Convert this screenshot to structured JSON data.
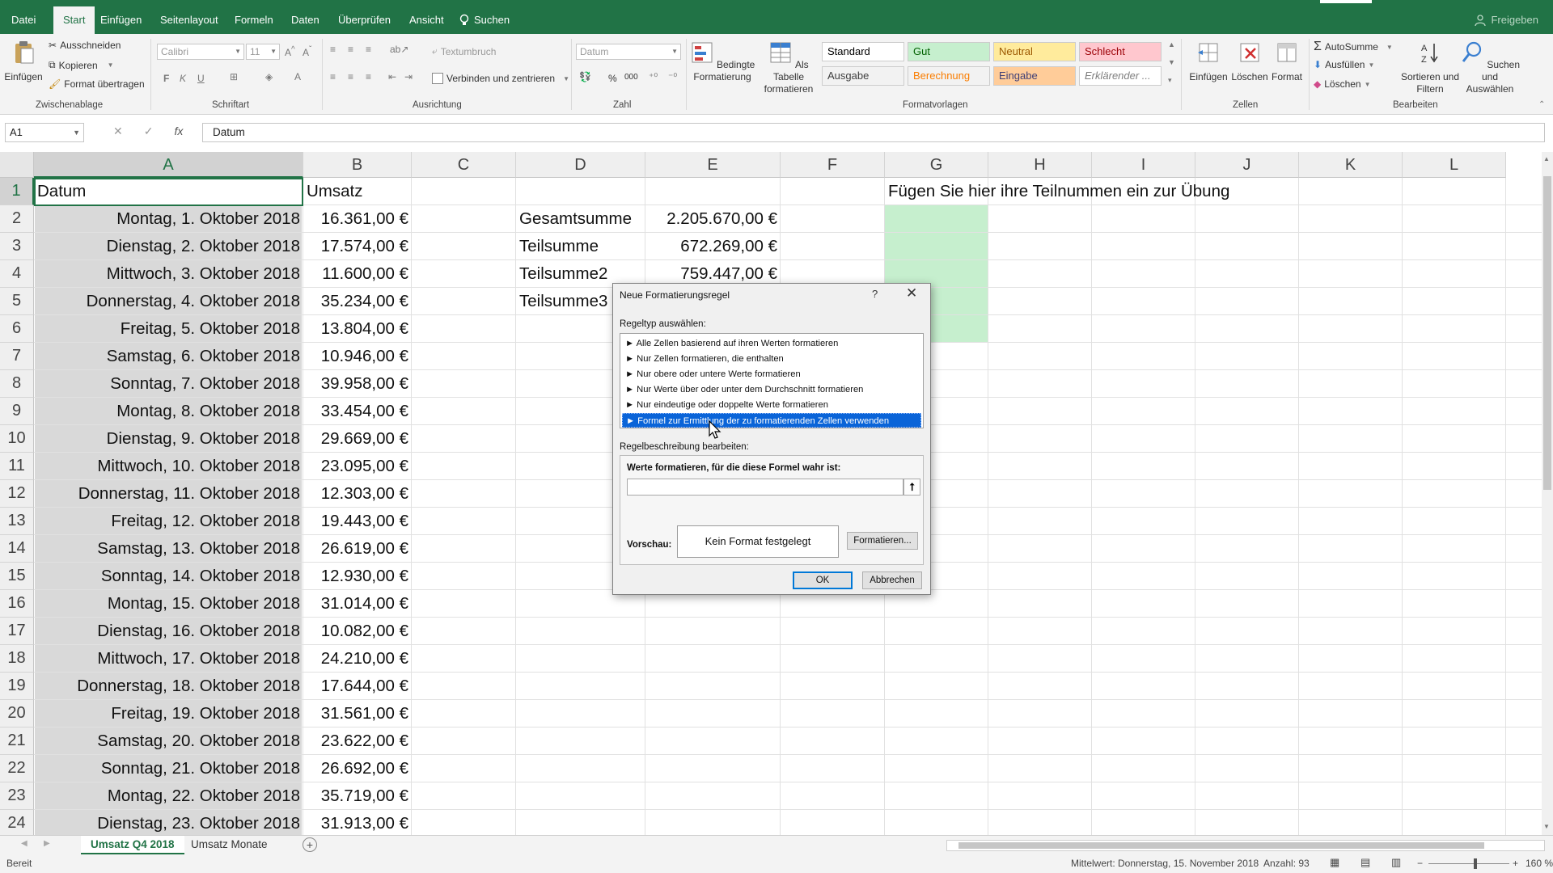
{
  "tabs": {
    "items": [
      "Datei",
      "Start",
      "Einfügen",
      "Seitenlayout",
      "Formeln",
      "Daten",
      "Überprüfen",
      "Ansicht"
    ],
    "search": "Suchen",
    "share": "Freigeben"
  },
  "ribbon": {
    "clipboard": {
      "paste": "Einfügen",
      "cut": "Ausschneiden",
      "copy": "Kopieren",
      "format_painter": "Format übertragen",
      "label": "Zwischenablage"
    },
    "font": {
      "name": "Calibri",
      "size": "11",
      "bold": "F",
      "italic": "K",
      "underline": "U",
      "label": "Schriftart"
    },
    "alignment": {
      "wrap": "Textumbruch",
      "merge": "Verbinden und zentrieren",
      "label": "Ausrichtung"
    },
    "number": {
      "format": "Datum",
      "percent": "%",
      "thousands": "000",
      "label": "Zahl"
    },
    "styles": {
      "conditional": "Bedingte Formatierung",
      "as_table": "Als Tabelle formatieren",
      "cells": [
        {
          "label": "Standard",
          "bg": "#ffffff",
          "fg": "#000000"
        },
        {
          "label": "Gut",
          "bg": "#c6efce",
          "fg": "#006100"
        },
        {
          "label": "Neutral",
          "bg": "#ffeb9c",
          "fg": "#9c5700"
        },
        {
          "label": "Schlecht",
          "bg": "#ffc7ce",
          "fg": "#9c0006"
        },
        {
          "label": "Ausgabe",
          "bg": "#f2f2f2",
          "fg": "#3f3f3f"
        },
        {
          "label": "Berechnung",
          "bg": "#f2f2f2",
          "fg": "#fa7d00"
        },
        {
          "label": "Eingabe",
          "bg": "#ffcc99",
          "fg": "#3f3f76"
        },
        {
          "label": "Erklärender ...",
          "bg": "#ffffff",
          "fg": "#7f7f7f"
        }
      ],
      "label": "Formatvorlagen"
    },
    "cells": {
      "insert": "Einfügen",
      "delete": "Löschen",
      "format": "Format",
      "label": "Zellen"
    },
    "editing": {
      "autosum": "AutoSumme",
      "fill": "Ausfüllen",
      "clear": "Löschen",
      "sort": "Sortieren und Filtern",
      "find": "Suchen und Auswählen",
      "label": "Bearbeiten"
    }
  },
  "formula_bar": {
    "name_box": "A1",
    "fx": "fx",
    "content": "Datum"
  },
  "grid": {
    "columns": [
      "A",
      "B",
      "C",
      "D",
      "E",
      "F",
      "G",
      "H",
      "I",
      "J",
      "K",
      "L"
    ],
    "rows": [
      "1",
      "2",
      "3",
      "4",
      "5",
      "6",
      "7",
      "8",
      "9",
      "10",
      "11",
      "12",
      "13",
      "14",
      "15",
      "16",
      "17",
      "18",
      "19",
      "20",
      "21",
      "22",
      "23",
      "24"
    ],
    "header_a": "Datum",
    "header_b": "Umsatz",
    "dates": [
      "Montag, 1. Oktober 2018",
      "Dienstag, 2. Oktober 2018",
      "Mittwoch, 3. Oktober 2018",
      "Donnerstag, 4. Oktober 2018",
      "Freitag, 5. Oktober 2018",
      "Samstag, 6. Oktober 2018",
      "Sonntag, 7. Oktober 2018",
      "Montag, 8. Oktober 2018",
      "Dienstag, 9. Oktober 2018",
      "Mittwoch, 10. Oktober 2018",
      "Donnerstag, 11. Oktober 2018",
      "Freitag, 12. Oktober 2018",
      "Samstag, 13. Oktober 2018",
      "Sonntag, 14. Oktober 2018",
      "Montag, 15. Oktober 2018",
      "Dienstag, 16. Oktober 2018",
      "Mittwoch, 17. Oktober 2018",
      "Donnerstag, 18. Oktober 2018",
      "Freitag, 19. Oktober 2018",
      "Samstag, 20. Oktober 2018",
      "Sonntag, 21. Oktober 2018",
      "Montag, 22. Oktober 2018",
      "Dienstag, 23. Oktober 2018"
    ],
    "umsatz": [
      "16.361,00 €",
      "17.574,00 €",
      "11.600,00 €",
      "35.234,00 €",
      "13.804,00 €",
      "10.946,00 €",
      "39.958,00 €",
      "33.454,00 €",
      "29.669,00 €",
      "23.095,00 €",
      "12.303,00 €",
      "19.443,00 €",
      "26.619,00 €",
      "12.930,00 €",
      "31.014,00 €",
      "10.082,00 €",
      "24.210,00 €",
      "17.644,00 €",
      "31.561,00 €",
      "23.622,00 €",
      "26.692,00 €",
      "35.719,00 €",
      "31.913,00 €"
    ],
    "summary_labels": [
      "Gesamtsumme",
      "Teilsumme",
      "Teilsumme2",
      "Teilsumme3"
    ],
    "summary_values": [
      "2.205.670,00 €",
      "672.269,00 €",
      "759.447,00 €"
    ],
    "note": "Fügen Sie hier ihre Teilnummen ein zur Übung"
  },
  "dialog": {
    "title": "Neue Formatierungsregel",
    "help": "?",
    "close": "✕",
    "rule_type_label": "Regeltyp auswählen:",
    "rule_types": [
      "► Alle Zellen basierend auf ihren Werten formatieren",
      "► Nur Zellen formatieren, die enthalten",
      "► Nur obere oder untere Werte formatieren",
      "► Nur Werte über oder unter dem Durchschnitt formatieren",
      "► Nur eindeutige oder doppelte Werte formatieren",
      "► Formel zur Ermittlung der zu formatierenden Zellen verwenden"
    ],
    "description_label": "Regelbeschreibung bearbeiten:",
    "formula_label": "Werte formatieren, für die diese Formel wahr ist:",
    "formula_value": "",
    "preview_label": "Vorschau:",
    "preview_text": "Kein Format festgelegt",
    "format_button": "Formatieren...",
    "ok": "OK",
    "cancel": "Abbrechen"
  },
  "sheets": {
    "tabs": [
      "Umsatz Q4 2018",
      "Umsatz Monate"
    ],
    "add": "+"
  },
  "status": {
    "ready": "Bereit",
    "average": "Mittelwert: Donnerstag, 15. November 2018",
    "count": "Anzahl: 93",
    "zoom": "160 %"
  },
  "colors": {
    "accent": "#217346",
    "selection": "#0a64d8",
    "green_fill": "#c6efce"
  }
}
